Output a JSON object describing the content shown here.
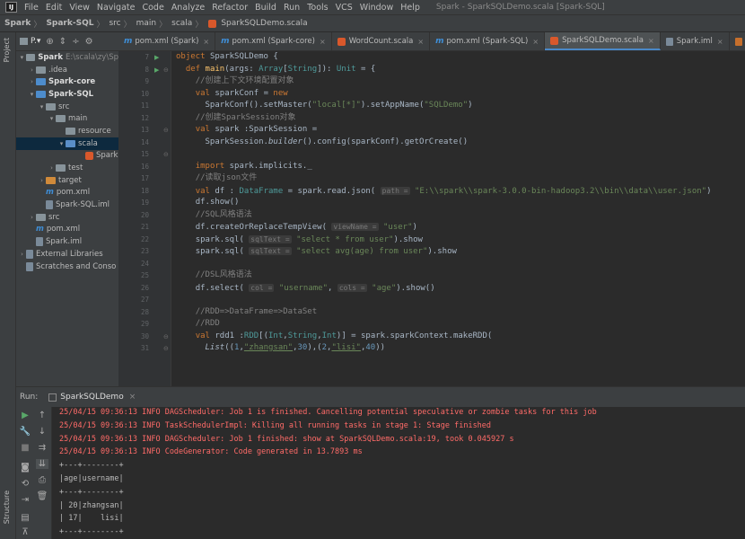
{
  "menu": {
    "items": [
      "File",
      "Edit",
      "View",
      "Navigate",
      "Code",
      "Analyze",
      "Refactor",
      "Build",
      "Run",
      "Tools",
      "VCS",
      "Window",
      "Help"
    ],
    "window_title": "Spark - SparkSQLDemo.scala [Spark-SQL]"
  },
  "breadcrumb": [
    "Spark",
    "Spark-SQL",
    "src",
    "main",
    "scala",
    "SparkSQLDemo.scala"
  ],
  "project": {
    "title": "P.▾",
    "tree": [
      {
        "label": "Spark",
        "extra": "E:\\scala\\zy\\Sp",
        "indent": 0,
        "arrow": "▾",
        "icon": "folder-grey",
        "bold": true
      },
      {
        "label": ".idea",
        "indent": 1,
        "arrow": "›",
        "icon": "folder-grey"
      },
      {
        "label": "Spark-core",
        "indent": 1,
        "arrow": "›",
        "icon": "folder-blue",
        "bold": true
      },
      {
        "label": "Spark-SQL",
        "indent": 1,
        "arrow": "▾",
        "icon": "folder-blue",
        "bold": true
      },
      {
        "label": "src",
        "indent": 2,
        "arrow": "▾",
        "icon": "folder-grey"
      },
      {
        "label": "main",
        "indent": 3,
        "arrow": "▾",
        "icon": "folder-grey"
      },
      {
        "label": "resource",
        "indent": 4,
        "arrow": "",
        "icon": "folder-grey"
      },
      {
        "label": "scala",
        "indent": 4,
        "arrow": "▾",
        "icon": "folder-src",
        "selected": true
      },
      {
        "label": "Spark",
        "indent": 6,
        "arrow": "",
        "icon": "scala-file"
      },
      {
        "label": "test",
        "indent": 3,
        "arrow": "›",
        "icon": "folder-grey"
      },
      {
        "label": "target",
        "indent": 2,
        "arrow": "›",
        "icon": "folder-orange"
      },
      {
        "label": "pom.xml",
        "indent": 2,
        "arrow": "",
        "icon": "maven"
      },
      {
        "label": "Spark-SQL.iml",
        "indent": 2,
        "arrow": "",
        "icon": "file"
      },
      {
        "label": "src",
        "indent": 1,
        "arrow": "›",
        "icon": "folder-grey"
      },
      {
        "label": "pom.xml",
        "indent": 1,
        "arrow": "",
        "icon": "maven"
      },
      {
        "label": "Spark.iml",
        "indent": 1,
        "arrow": "",
        "icon": "file"
      },
      {
        "label": "External Libraries",
        "indent": 0,
        "arrow": "›",
        "icon": "libs"
      },
      {
        "label": "Scratches and Conso",
        "indent": 0,
        "arrow": "",
        "icon": "scratch"
      }
    ]
  },
  "tabs": [
    {
      "label": "pom.xml (Spark)",
      "icon": "m"
    },
    {
      "label": "pom.xml (Spark-core)",
      "icon": "m"
    },
    {
      "label": "WordCount.scala",
      "icon": "scala"
    },
    {
      "label": "pom.xml (Spark-SQL)",
      "icon": "m"
    },
    {
      "label": "SparkSQLDemo.scala",
      "icon": "scala",
      "active": true
    },
    {
      "label": "Spark.iml",
      "icon": "file"
    },
    {
      "label": "log4j.propert",
      "icon": "props"
    }
  ],
  "code": {
    "line_numbers": [
      "7",
      "8",
      "9",
      "10",
      "11",
      "12",
      "13",
      "14",
      "15",
      "16",
      "17",
      "18",
      "19",
      "20",
      "21",
      "22",
      "23",
      "24",
      "25",
      "26",
      "27",
      "28",
      "29",
      "30",
      "31"
    ],
    "l7": {
      "kw": "object ",
      "name": "SparkSQLDemo {"
    },
    "l8": {
      "indent": "  ",
      "kw": "def ",
      "fn": "main",
      "a": "(args: ",
      "ty": "Array",
      "b": "[",
      "ty2": "String",
      "c": "]): ",
      "ty3": "Unit",
      "d": " = {"
    },
    "l9": {
      "indent": "    ",
      "text": "//创建上下文环境配置对象"
    },
    "l10": {
      "indent": "    ",
      "kw": "val ",
      "name": "sparkConf",
      "eq": " = ",
      "kw2": "new"
    },
    "l11": {
      "indent": "      ",
      "a": "SparkConf().setMaster(",
      "s1": "\"local[*]\"",
      "b": ").setAppName(",
      "s2": "\"SQLDemo\"",
      "c": ")"
    },
    "l12": {
      "indent": "    ",
      "text": "//创建SparkSession对象"
    },
    "l13": {
      "indent": "    ",
      "kw": "val ",
      "name": "spark",
      "rest": " :SparkSession ="
    },
    "l14": {
      "indent": "      ",
      "a": "SparkSession.",
      "it": "builder",
      "b": "().config(sparkConf).getOrCreate()"
    },
    "l16": {
      "indent": "    ",
      "kw": "import ",
      "rest": "spark.implicits._"
    },
    "l17": {
      "indent": "    ",
      "text": "//读取json文件"
    },
    "l18": {
      "indent": "    ",
      "kw": "val ",
      "name": "df",
      "a": " : ",
      "ty": "DataFrame",
      "b": " = spark.read.json( ",
      "hint": "path =",
      "s": "\"E:\\\\spark\\\\spark-3.0.0-bin-hadoop3.2\\\\bin\\\\data\\\\user.json\"",
      "c": ")"
    },
    "l19": {
      "indent": "    ",
      "text": "df.show()"
    },
    "l20": {
      "indent": "    ",
      "text": "//SQL风格语法"
    },
    "l21": {
      "indent": "    ",
      "a": "df.createOrReplaceTempView( ",
      "hint": "viewName =",
      "s": "\"user\"",
      "c": ")"
    },
    "l22": {
      "indent": "    ",
      "a": "spark.sql( ",
      "hint": "sqlText =",
      "s": "\"select * from user\"",
      "c": ").show"
    },
    "l23": {
      "indent": "    ",
      "a": "spark.sql( ",
      "hint": "sqlText =",
      "s": "\"select avg(age) from user\"",
      "c": ").show"
    },
    "l25": {
      "indent": "    ",
      "text": "//DSL风格语法"
    },
    "l26": {
      "indent": "    ",
      "a": "df.select( ",
      "hint1": "col =",
      "s1": "\"username\"",
      "b": ", ",
      "hint2": "cols =",
      "s2": "\"age\"",
      "c": ").show()"
    },
    "l28": {
      "indent": "    ",
      "text": "//RDD=>DataFrame=>DataSet"
    },
    "l29": {
      "indent": "    ",
      "text": "//RDD"
    },
    "l30": {
      "indent": "    ",
      "kw": "val ",
      "name": "rdd1",
      "a": " :",
      "ty": "RDD",
      "b": "[(",
      "ty2": "Int",
      "c": ",",
      "ty3": "String",
      "d": ",",
      "ty4": "Int",
      "e": ")] = spark.sparkContext.makeRDD("
    },
    "l31": {
      "indent": "      ",
      "it": "List",
      "a": "((",
      "n1": "1",
      "b": ",",
      "s1": "\"zhangsan\"",
      "c": ",",
      "n2": "30",
      "d": "),(",
      "n3": "2",
      "e": ",",
      "s2": "\"lisi\"",
      "f": ",",
      "n4": "40",
      "g": "))"
    }
  },
  "run": {
    "label": "Run:",
    "tab": "SparkSQLDemo",
    "lines": [
      {
        "kind": "err",
        "text": "25/04/15 09:36:13 INFO DAGScheduler: Job 1 is finished. Cancelling potential speculative or zombie tasks for this job"
      },
      {
        "kind": "err",
        "text": "25/04/15 09:36:13 INFO TaskSchedulerImpl: Killing all running tasks in stage 1: Stage finished"
      },
      {
        "kind": "err",
        "text": "25/04/15 09:36:13 INFO DAGScheduler: Job 1 finished: show at SparkSQLDemo.scala:19, took 0.045927 s"
      },
      {
        "kind": "err",
        "text": "25/04/15 09:36:13 INFO CodeGenerator: Code generated in 13.7893 ms"
      },
      {
        "kind": "out",
        "text": "+---+--------+"
      },
      {
        "kind": "out",
        "text": "|age|username|"
      },
      {
        "kind": "out",
        "text": "+---+--------+"
      },
      {
        "kind": "out",
        "text": "| 20|zhangsan|"
      },
      {
        "kind": "out",
        "text": "| 17|    lisi|"
      },
      {
        "kind": "out",
        "text": "+---+--------+"
      }
    ]
  },
  "side_tabs": {
    "project": "Project",
    "structure": "Structure"
  }
}
